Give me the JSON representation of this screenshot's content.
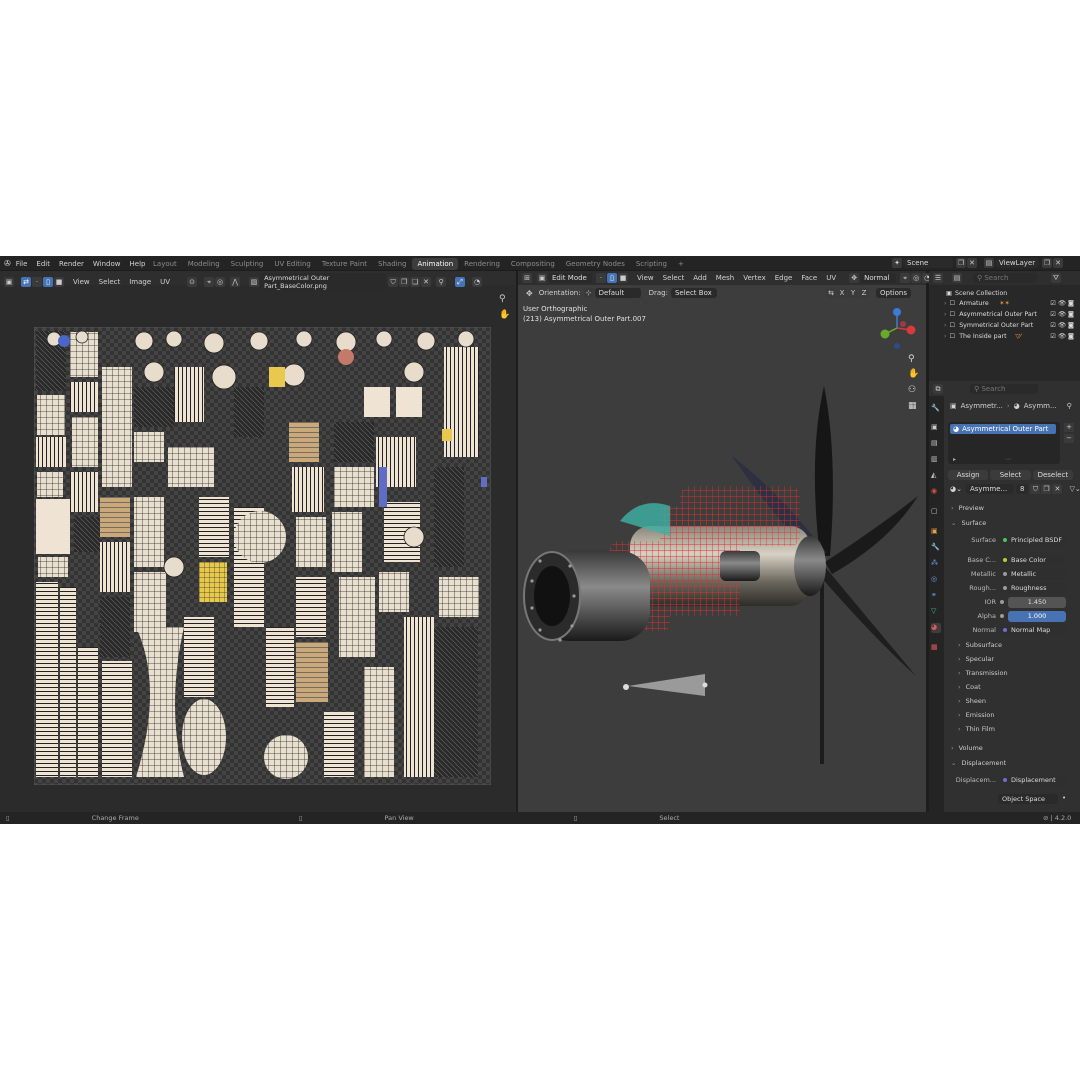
{
  "menu": [
    "File",
    "Edit",
    "Render",
    "Window",
    "Help"
  ],
  "workspaces": [
    "Layout",
    "Modeling",
    "Sculpting",
    "UV Editing",
    "Texture Paint",
    "Shading",
    "Animation",
    "Rendering",
    "Compositing",
    "Geometry Nodes",
    "Scripting",
    "+"
  ],
  "active_workspace": "Animation",
  "scene": {
    "name": "Scene",
    "view_layer": "ViewLayer"
  },
  "image_editor": {
    "menus": [
      "View",
      "Select",
      "Image",
      "UV"
    ],
    "image_name": "Asymmetrical Outer Part_BaseColor.png"
  },
  "viewport": {
    "mode": "Edit Mode",
    "menus": [
      "View",
      "Select",
      "Add",
      "Mesh",
      "Vertex",
      "Edge",
      "Face",
      "UV"
    ],
    "shading": "Normal",
    "orientation_label": "Orientation:",
    "orientation_value": "Default",
    "drag_label": "Drag:",
    "drag_value": "Select Box",
    "axes": [
      "X",
      "Y",
      "Z"
    ],
    "options_label": "Options",
    "view_name": "User Orthographic",
    "object_info": "(213) Asymmetrical Outer Part.007"
  },
  "outliner": {
    "search_placeholder": "Search",
    "root": "Scene Collection",
    "items": [
      "Armature",
      "Asymmetrical Outer Part",
      "Symmetrical Outer Part",
      "The Inside part"
    ]
  },
  "properties": {
    "search_placeholder": "Search",
    "breadcrumb": [
      "Asymmetr...",
      "Asymm..."
    ],
    "material_slot": "Asymmetrical Outer Part",
    "buttons": {
      "assign": "Assign",
      "select": "Select",
      "deselect": "Deselect"
    },
    "material_name": "Asymme...",
    "users": "8",
    "sections": {
      "preview": "Preview",
      "surface_header": "Surface"
    },
    "surface": {
      "label": "Surface",
      "value": "Principled BSDF"
    },
    "inputs": [
      {
        "label": "Base C...",
        "value": "Base Color"
      },
      {
        "label": "Metallic",
        "value": "Metallic"
      },
      {
        "label": "Rough...",
        "value": "Roughness"
      },
      {
        "label": "IOR",
        "value": "1.450"
      },
      {
        "label": "Alpha",
        "value": "1.000"
      },
      {
        "label": "Normal",
        "value": "Normal Map"
      }
    ],
    "subsections": [
      "Subsurface",
      "Specular",
      "Transmission",
      "Coat",
      "Sheen",
      "Emission",
      "Thin Film"
    ],
    "volume": "Volume",
    "displacement": "Displacement",
    "displacement_row": {
      "label": "Displacem...",
      "value": "Displacement"
    },
    "space": "Object Space"
  },
  "status_bar": {
    "items": [
      "Change Frame",
      "Pan View",
      "Select"
    ],
    "version": "4.2.0"
  },
  "colors": {
    "accent": "#4772b3",
    "active_ws": "#3d3d3d",
    "panel": "#303030",
    "viewport_bg": "#3d3d3d",
    "uv_bg": "#2b2b2b"
  }
}
